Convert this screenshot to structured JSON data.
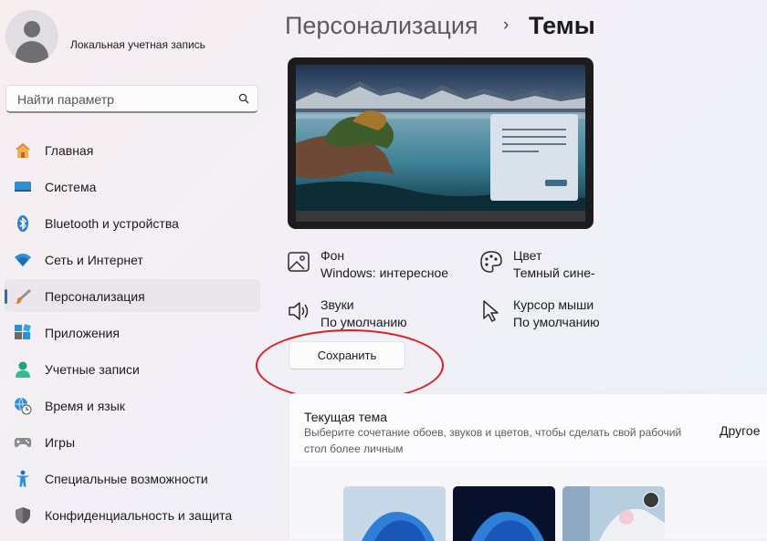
{
  "account": {
    "name": "Локальная учетная запись"
  },
  "search": {
    "placeholder": "Найти параметр"
  },
  "sidebar": {
    "items": [
      {
        "label": "Главная",
        "icon": "home-icon"
      },
      {
        "label": "Система",
        "icon": "monitor-icon"
      },
      {
        "label": "Bluetooth и устройства",
        "icon": "bluetooth-icon"
      },
      {
        "label": "Сеть и Интернет",
        "icon": "wifi-icon"
      },
      {
        "label": "Персонализация",
        "icon": "brush-icon",
        "active": true
      },
      {
        "label": "Приложения",
        "icon": "apps-icon"
      },
      {
        "label": "Учетные записи",
        "icon": "person-icon"
      },
      {
        "label": "Время и язык",
        "icon": "globe-clock-icon"
      },
      {
        "label": "Игры",
        "icon": "gamepad-icon"
      },
      {
        "label": "Специальные возможности",
        "icon": "accessibility-icon"
      },
      {
        "label": "Конфиденциальность и защита",
        "icon": "shield-icon"
      }
    ]
  },
  "header": {
    "parent": "Персонализация",
    "separator": "›",
    "current": "Темы"
  },
  "properties": {
    "background": {
      "title": "Фон",
      "value": "Windows: интересное",
      "icon": "picture-icon"
    },
    "color": {
      "title": "Цвет",
      "value": "Темный сине-",
      "icon": "palette-icon"
    },
    "sounds": {
      "title": "Звуки",
      "value": "По умолчанию",
      "icon": "speaker-icon"
    },
    "cursor": {
      "title": "Курсор мыши",
      "value": "По умолчанию",
      "icon": "cursor-icon"
    }
  },
  "save_button": {
    "label": "Сохранить"
  },
  "current_theme": {
    "title": "Текущая тема",
    "description": "Выберите сочетание обоев, звуков и цветов, чтобы сделать свой рабочий стол более личным",
    "value": "Другое"
  },
  "colors": {
    "accent": "#2a6eb5",
    "annotation": "#e21b23"
  }
}
